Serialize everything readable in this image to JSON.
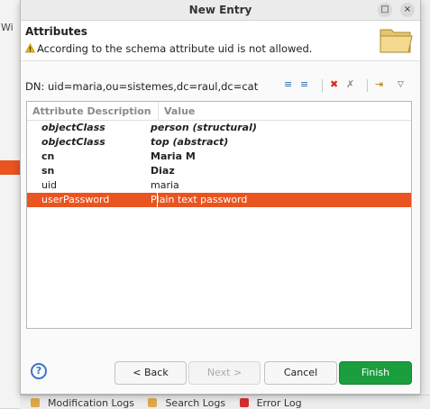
{
  "background": {
    "left_fragment": "Wi",
    "bottom_tabs": [
      "Modification Logs",
      "Search Logs",
      "Error Log"
    ]
  },
  "window": {
    "title": "New Entry",
    "maximize_glyph": "□",
    "close_glyph": "×"
  },
  "header": {
    "title": "Attributes",
    "message": "According to the schema attribute uid is not allowed."
  },
  "dn": "DN: uid=maria,ou=sistemes,dc=raul,dc=cat",
  "toolbar": {
    "icons": [
      "new-value-icon",
      "new-attribute-icon",
      "delete-icon",
      "delete-all-icon",
      "expand-icon",
      "view-menu-icon"
    ],
    "glyph_a": "≡",
    "glyph_b": "≡",
    "glyph_c": "✖",
    "glyph_d": "✗",
    "glyph_e": "⇥",
    "glyph_f": "▽"
  },
  "table": {
    "headers": [
      "Attribute Description",
      "Value"
    ],
    "rows": [
      {
        "key": "objectClass",
        "value": "person (structural)",
        "style": "bold-italic"
      },
      {
        "key": "objectClass",
        "value": "top (abstract)",
        "style": "bold-italic"
      },
      {
        "key": "cn",
        "value": "Maria M",
        "style": "bold"
      },
      {
        "key": "sn",
        "value": "Diaz",
        "style": "bold"
      },
      {
        "key": "uid",
        "value": "maria",
        "style": "normal"
      },
      {
        "key": "userPassword",
        "value": "Plain text password",
        "style": "selected"
      }
    ]
  },
  "buttons": {
    "help": "?",
    "back": "< Back",
    "next": "Next >",
    "cancel": "Cancel",
    "finish": "Finish"
  },
  "colors": {
    "accent": "#e95420",
    "finish": "#1b9e3e",
    "help": "#3a74c4"
  }
}
